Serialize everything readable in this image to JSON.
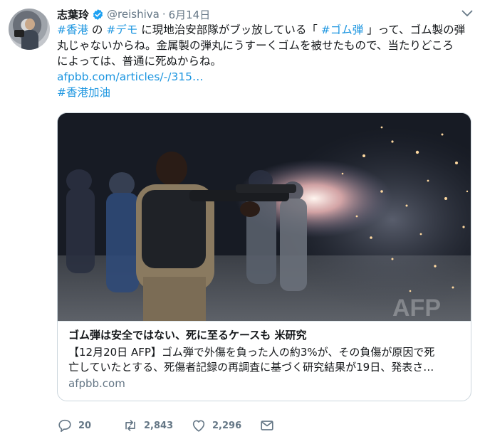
{
  "tweet": {
    "name": "志葉玲",
    "handle": "@reishiva",
    "separator": "·",
    "date": "6月14日",
    "lines": [
      [
        {
          "text": "#香港",
          "kind": "tag"
        },
        {
          "text": " の ",
          "kind": "plain"
        },
        {
          "text": "#デモ",
          "kind": "tag"
        },
        {
          "text": " に現地治安部隊がブッ放している「 ",
          "kind": "plain"
        },
        {
          "text": "#ゴム弾",
          "kind": "tag"
        },
        {
          "text": " 」って、ゴム製の弾",
          "kind": "plain"
        }
      ],
      [
        {
          "text": "丸じゃないからね。金属製の弾丸にうすーくゴムを被せたもので、当たりどころ",
          "kind": "plain"
        }
      ],
      [
        {
          "text": "によっては、普通に死ぬからね。",
          "kind": "plain"
        }
      ],
      [
        {
          "text": "afpbb.com/articles/-/315…",
          "kind": "link"
        }
      ],
      [
        {
          "text": "#香港加油",
          "kind": "tag"
        }
      ]
    ]
  },
  "card": {
    "title": "ゴム弾は安全ではない、死に至るケースも 米研究",
    "description_lines": [
      "【12月20日 AFP】ゴム弾で外傷を負った人の約3%が、その負傷が原因で死",
      "亡していたとする、死傷者記録の再調査に基づく研究結果が19日、発表さ…"
    ],
    "domain": "afpbb.com",
    "watermark": "AFP"
  },
  "actions": {
    "replies": "20",
    "retweets": "2,843",
    "likes": "2,296"
  },
  "colors": {
    "link": "#1b95e0",
    "secondary": "#657786",
    "text": "#14171a",
    "border": "#ccd6dd"
  },
  "icons": {
    "verified": "verified-badge-icon",
    "caret": "chevron-down-icon",
    "reply": "reply-icon",
    "retweet": "retweet-icon",
    "like": "heart-icon",
    "message": "envelope-icon"
  }
}
